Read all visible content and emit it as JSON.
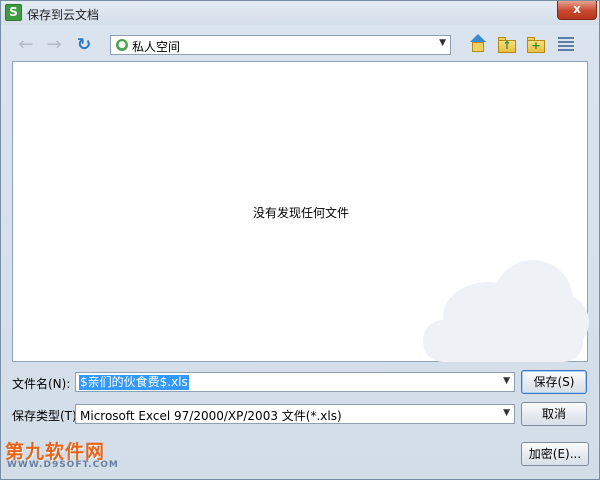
{
  "window": {
    "title": "保存到云文档",
    "app_icon_glyph": "S",
    "close_glyph": "x"
  },
  "nav": {
    "back_glyph": "←",
    "forward_glyph": "→",
    "refresh_glyph": "↻",
    "location": "私人空间",
    "dropdown_glyph": "▼"
  },
  "toolbar_icons": [
    "home-icon",
    "folder-up-icon",
    "new-folder-icon",
    "list-view-icon"
  ],
  "toolbar": {
    "up_glyph": "↑",
    "new_folder_glyph": "+"
  },
  "file_area": {
    "empty_message": "没有发现任何文件"
  },
  "form": {
    "filename_label": "文件名(N):",
    "filename_value": "$亲们的伙食费$.xls",
    "filetype_label": "保存类型(T):",
    "filetype_value": "Microsoft Excel 97/2000/XP/2003 文件(*.xls)",
    "dropdown_glyph": "▼"
  },
  "buttons": {
    "save": "保存(S)",
    "cancel": "取消",
    "encrypt": "加密(E)..."
  },
  "watermark": {
    "brand": "第九软件网",
    "url": "WWW.D9SOFT.COM"
  },
  "colors": {
    "selection": "#3399ff",
    "close_button": "#c6472b",
    "watermark_orange": "#e8641b"
  }
}
